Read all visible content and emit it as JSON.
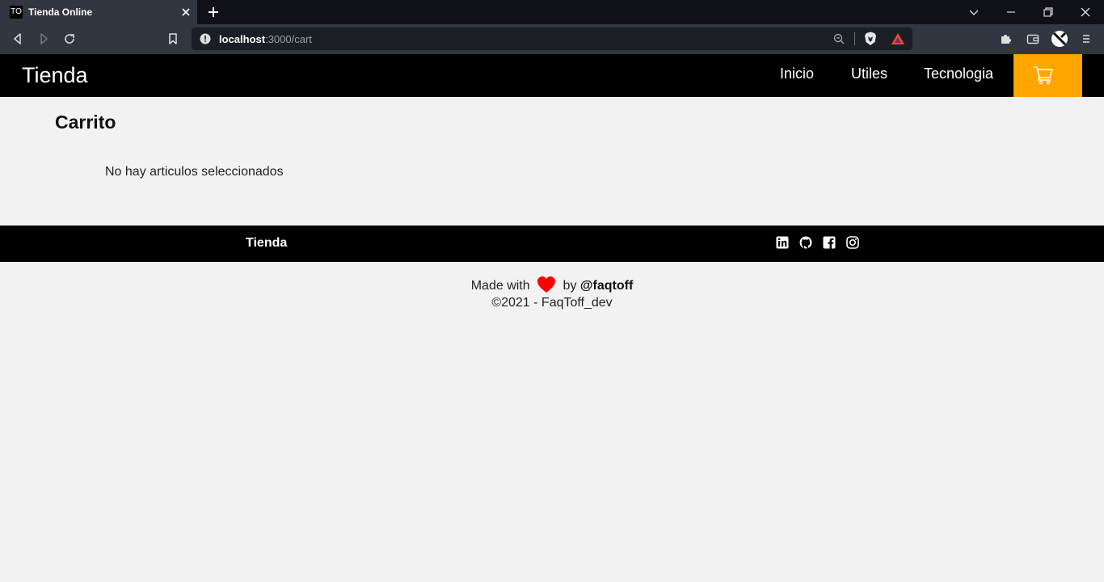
{
  "browser": {
    "tab_title": "Tienda Online",
    "favicon_text": "TO",
    "url_host": "localhost",
    "url_path": ":3000/cart"
  },
  "navbar": {
    "brand": "Tienda",
    "links": [
      "Inicio",
      "Utiles",
      "Tecnologia"
    ],
    "cart_icon": "shopping-cart-icon",
    "accent": "#ffa500"
  },
  "main": {
    "title": "Carrito",
    "empty_message": "No hay articulos seleccionados"
  },
  "footer": {
    "brand": "Tienda",
    "social_icons": [
      "linkedin-icon",
      "github-icon",
      "facebook-icon",
      "instagram-icon"
    ]
  },
  "credits": {
    "made_with": "Made with",
    "by": "by",
    "author": "@faqtoff",
    "heart_color": "#ff0000",
    "copyright": "©2021 - FaqToff_dev"
  }
}
